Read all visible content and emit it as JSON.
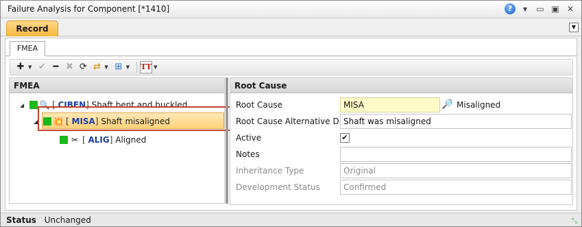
{
  "window": {
    "title": "Failure Analysis for Component [*1410]"
  },
  "ribbon": {
    "tab_record": "Record"
  },
  "tabs": {
    "fmea": "FMEA"
  },
  "toolbar": {
    "text_format": "TT"
  },
  "left_panel": {
    "header": "FMEA",
    "tree": [
      {
        "code": "CIBEN",
        "label": "Shaft bent and buckled"
      },
      {
        "code": "MISA",
        "label": "Shaft misaligned"
      },
      {
        "code": "ALIG",
        "label": "Aligned"
      }
    ]
  },
  "right_panel": {
    "header": "Root Cause",
    "fields": {
      "root_cause_label": "Root Cause",
      "root_cause_value": "MISA",
      "root_cause_desc": "Misaligned",
      "alt_desc_label": "Root Cause Alternative De",
      "alt_desc_value": "Shaft was misaligned",
      "active_label": "Active",
      "notes_label": "Notes",
      "notes_value": "",
      "inheritance_label": "Inheritance Type",
      "inheritance_value": "Original",
      "dev_status_label": "Development Status",
      "dev_status_value": "Confirmed"
    }
  },
  "status": {
    "label": "Status",
    "value": "Unchanged"
  }
}
